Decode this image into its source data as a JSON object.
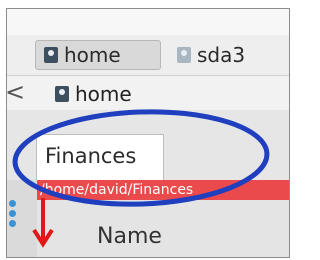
{
  "path_bar": {
    "crumbs": [
      {
        "label": "home",
        "active": true,
        "icon": "drive-icon"
      },
      {
        "label": "sda3",
        "active": false,
        "icon": "drive-icon"
      }
    ]
  },
  "nav_row": {
    "back_glyph": "<",
    "crumb_label": "home"
  },
  "tabs": [
    {
      "label": "Finances"
    }
  ],
  "location_bar": {
    "path": "/home/david/Finances",
    "color": "#ea4a4c"
  },
  "file_list": {
    "columns": [
      {
        "label": "Name"
      }
    ]
  },
  "annotation": {
    "ellipse_color": "#1f3fbf",
    "sort_arrow_color": "#e01818"
  }
}
